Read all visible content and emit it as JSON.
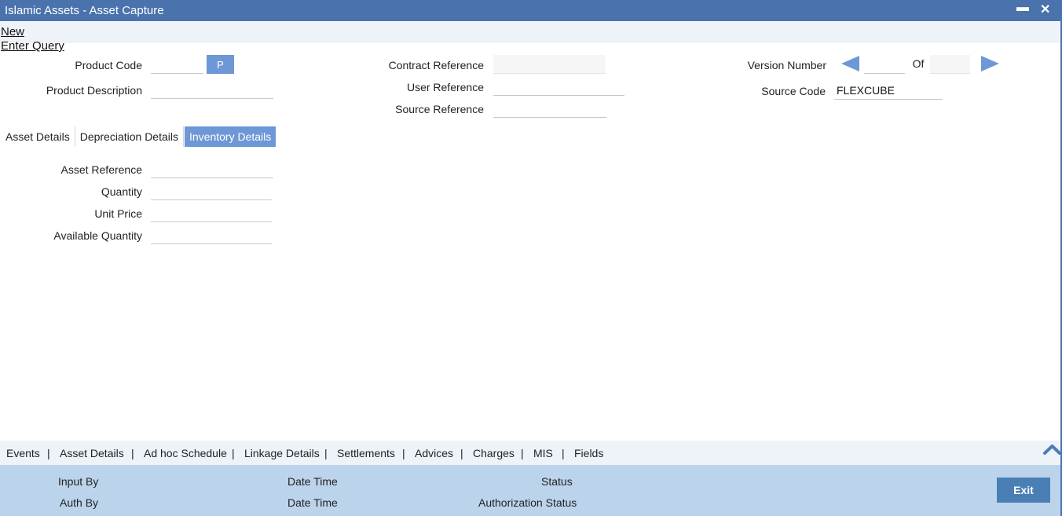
{
  "window": {
    "title": "Islamic Assets - Asset Capture"
  },
  "toolbar": {
    "new_label": "New",
    "enter_query_label": "Enter Query"
  },
  "header": {
    "product_code": {
      "label": "Product Code",
      "value": ""
    },
    "p_button": "P",
    "product_description": {
      "label": "Product Description",
      "value": ""
    },
    "contract_reference": {
      "label": "Contract Reference",
      "value": ""
    },
    "user_reference": {
      "label": "User Reference",
      "value": ""
    },
    "source_reference": {
      "label": "Source Reference",
      "value": ""
    },
    "version_number": {
      "label": "Version Number",
      "value": ""
    },
    "of_label": "Of",
    "of_value": "",
    "source_code": {
      "label": "Source Code",
      "value": "FLEXCUBE"
    }
  },
  "tabs": [
    {
      "label": "Asset Details",
      "active": false
    },
    {
      "label": "Depreciation Details",
      "active": false
    },
    {
      "label": "Inventory Details",
      "active": true
    }
  ],
  "inventory": {
    "asset_reference": {
      "label": "Asset Reference",
      "value": ""
    },
    "quantity": {
      "label": "Quantity",
      "value": ""
    },
    "unit_price": {
      "label": "Unit Price",
      "value": ""
    },
    "available_quantity": {
      "label": "Available Quantity",
      "value": ""
    }
  },
  "bottom_nav": [
    "Events",
    "Asset Details",
    "Ad hoc Schedule",
    "Linkage Details",
    "Settlements",
    "Advices",
    "Charges",
    "MIS",
    "Fields"
  ],
  "nav_separator": "|",
  "footer": {
    "input_by": "Input By",
    "auth_by": "Auth By",
    "date_time_1": "Date Time",
    "date_time_2": "Date Time",
    "status": "Status",
    "authorization_status": "Authorization Status",
    "exit_label": "Exit"
  },
  "icons": {
    "minimize": "minimize-icon",
    "close": "close-icon",
    "prev": "arrow-left-icon",
    "next": "arrow-right-icon",
    "collapse": "chevron-up-icon"
  },
  "colors": {
    "titlebar": "#4a73ae",
    "accent": "#6d97d6",
    "footer": "#bcd4eb",
    "exit": "#4a7fb5"
  }
}
